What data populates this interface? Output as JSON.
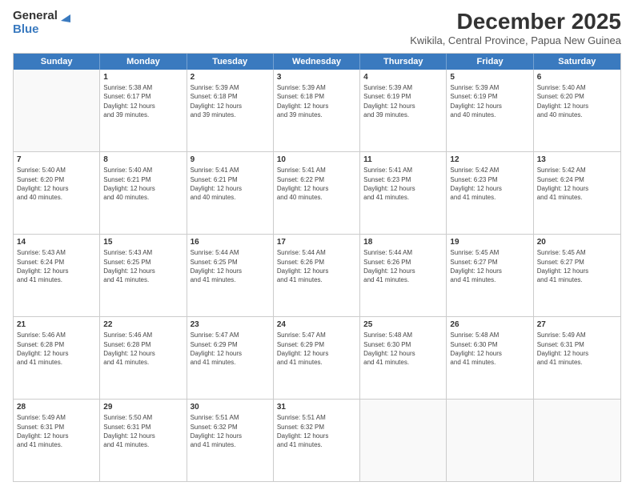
{
  "logo": {
    "general": "General",
    "blue": "Blue"
  },
  "title": "December 2025",
  "location": "Kwikila, Central Province, Papua New Guinea",
  "header": {
    "days": [
      "Sunday",
      "Monday",
      "Tuesday",
      "Wednesday",
      "Thursday",
      "Friday",
      "Saturday"
    ]
  },
  "weeks": [
    [
      {
        "day": "",
        "empty": true,
        "lines": []
      },
      {
        "day": "1",
        "empty": false,
        "lines": [
          "Sunrise: 5:38 AM",
          "Sunset: 6:17 PM",
          "Daylight: 12 hours",
          "and 39 minutes."
        ]
      },
      {
        "day": "2",
        "empty": false,
        "lines": [
          "Sunrise: 5:39 AM",
          "Sunset: 6:18 PM",
          "Daylight: 12 hours",
          "and 39 minutes."
        ]
      },
      {
        "day": "3",
        "empty": false,
        "lines": [
          "Sunrise: 5:39 AM",
          "Sunset: 6:18 PM",
          "Daylight: 12 hours",
          "and 39 minutes."
        ]
      },
      {
        "day": "4",
        "empty": false,
        "lines": [
          "Sunrise: 5:39 AM",
          "Sunset: 6:19 PM",
          "Daylight: 12 hours",
          "and 39 minutes."
        ]
      },
      {
        "day": "5",
        "empty": false,
        "lines": [
          "Sunrise: 5:39 AM",
          "Sunset: 6:19 PM",
          "Daylight: 12 hours",
          "and 40 minutes."
        ]
      },
      {
        "day": "6",
        "empty": false,
        "lines": [
          "Sunrise: 5:40 AM",
          "Sunset: 6:20 PM",
          "Daylight: 12 hours",
          "and 40 minutes."
        ]
      }
    ],
    [
      {
        "day": "7",
        "empty": false,
        "lines": [
          "Sunrise: 5:40 AM",
          "Sunset: 6:20 PM",
          "Daylight: 12 hours",
          "and 40 minutes."
        ]
      },
      {
        "day": "8",
        "empty": false,
        "lines": [
          "Sunrise: 5:40 AM",
          "Sunset: 6:21 PM",
          "Daylight: 12 hours",
          "and 40 minutes."
        ]
      },
      {
        "day": "9",
        "empty": false,
        "lines": [
          "Sunrise: 5:41 AM",
          "Sunset: 6:21 PM",
          "Daylight: 12 hours",
          "and 40 minutes."
        ]
      },
      {
        "day": "10",
        "empty": false,
        "lines": [
          "Sunrise: 5:41 AM",
          "Sunset: 6:22 PM",
          "Daylight: 12 hours",
          "and 40 minutes."
        ]
      },
      {
        "day": "11",
        "empty": false,
        "lines": [
          "Sunrise: 5:41 AM",
          "Sunset: 6:23 PM",
          "Daylight: 12 hours",
          "and 41 minutes."
        ]
      },
      {
        "day": "12",
        "empty": false,
        "lines": [
          "Sunrise: 5:42 AM",
          "Sunset: 6:23 PM",
          "Daylight: 12 hours",
          "and 41 minutes."
        ]
      },
      {
        "day": "13",
        "empty": false,
        "lines": [
          "Sunrise: 5:42 AM",
          "Sunset: 6:24 PM",
          "Daylight: 12 hours",
          "and 41 minutes."
        ]
      }
    ],
    [
      {
        "day": "14",
        "empty": false,
        "lines": [
          "Sunrise: 5:43 AM",
          "Sunset: 6:24 PM",
          "Daylight: 12 hours",
          "and 41 minutes."
        ]
      },
      {
        "day": "15",
        "empty": false,
        "lines": [
          "Sunrise: 5:43 AM",
          "Sunset: 6:25 PM",
          "Daylight: 12 hours",
          "and 41 minutes."
        ]
      },
      {
        "day": "16",
        "empty": false,
        "lines": [
          "Sunrise: 5:44 AM",
          "Sunset: 6:25 PM",
          "Daylight: 12 hours",
          "and 41 minutes."
        ]
      },
      {
        "day": "17",
        "empty": false,
        "lines": [
          "Sunrise: 5:44 AM",
          "Sunset: 6:26 PM",
          "Daylight: 12 hours",
          "and 41 minutes."
        ]
      },
      {
        "day": "18",
        "empty": false,
        "lines": [
          "Sunrise: 5:44 AM",
          "Sunset: 6:26 PM",
          "Daylight: 12 hours",
          "and 41 minutes."
        ]
      },
      {
        "day": "19",
        "empty": false,
        "lines": [
          "Sunrise: 5:45 AM",
          "Sunset: 6:27 PM",
          "Daylight: 12 hours",
          "and 41 minutes."
        ]
      },
      {
        "day": "20",
        "empty": false,
        "lines": [
          "Sunrise: 5:45 AM",
          "Sunset: 6:27 PM",
          "Daylight: 12 hours",
          "and 41 minutes."
        ]
      }
    ],
    [
      {
        "day": "21",
        "empty": false,
        "lines": [
          "Sunrise: 5:46 AM",
          "Sunset: 6:28 PM",
          "Daylight: 12 hours",
          "and 41 minutes."
        ]
      },
      {
        "day": "22",
        "empty": false,
        "lines": [
          "Sunrise: 5:46 AM",
          "Sunset: 6:28 PM",
          "Daylight: 12 hours",
          "and 41 minutes."
        ]
      },
      {
        "day": "23",
        "empty": false,
        "lines": [
          "Sunrise: 5:47 AM",
          "Sunset: 6:29 PM",
          "Daylight: 12 hours",
          "and 41 minutes."
        ]
      },
      {
        "day": "24",
        "empty": false,
        "lines": [
          "Sunrise: 5:47 AM",
          "Sunset: 6:29 PM",
          "Daylight: 12 hours",
          "and 41 minutes."
        ]
      },
      {
        "day": "25",
        "empty": false,
        "lines": [
          "Sunrise: 5:48 AM",
          "Sunset: 6:30 PM",
          "Daylight: 12 hours",
          "and 41 minutes."
        ]
      },
      {
        "day": "26",
        "empty": false,
        "lines": [
          "Sunrise: 5:48 AM",
          "Sunset: 6:30 PM",
          "Daylight: 12 hours",
          "and 41 minutes."
        ]
      },
      {
        "day": "27",
        "empty": false,
        "lines": [
          "Sunrise: 5:49 AM",
          "Sunset: 6:31 PM",
          "Daylight: 12 hours",
          "and 41 minutes."
        ]
      }
    ],
    [
      {
        "day": "28",
        "empty": false,
        "lines": [
          "Sunrise: 5:49 AM",
          "Sunset: 6:31 PM",
          "Daylight: 12 hours",
          "and 41 minutes."
        ]
      },
      {
        "day": "29",
        "empty": false,
        "lines": [
          "Sunrise: 5:50 AM",
          "Sunset: 6:31 PM",
          "Daylight: 12 hours",
          "and 41 minutes."
        ]
      },
      {
        "day": "30",
        "empty": false,
        "lines": [
          "Sunrise: 5:51 AM",
          "Sunset: 6:32 PM",
          "Daylight: 12 hours",
          "and 41 minutes."
        ]
      },
      {
        "day": "31",
        "empty": false,
        "lines": [
          "Sunrise: 5:51 AM",
          "Sunset: 6:32 PM",
          "Daylight: 12 hours",
          "and 41 minutes."
        ]
      },
      {
        "day": "",
        "empty": true,
        "lines": []
      },
      {
        "day": "",
        "empty": true,
        "lines": []
      },
      {
        "day": "",
        "empty": true,
        "lines": []
      }
    ]
  ]
}
